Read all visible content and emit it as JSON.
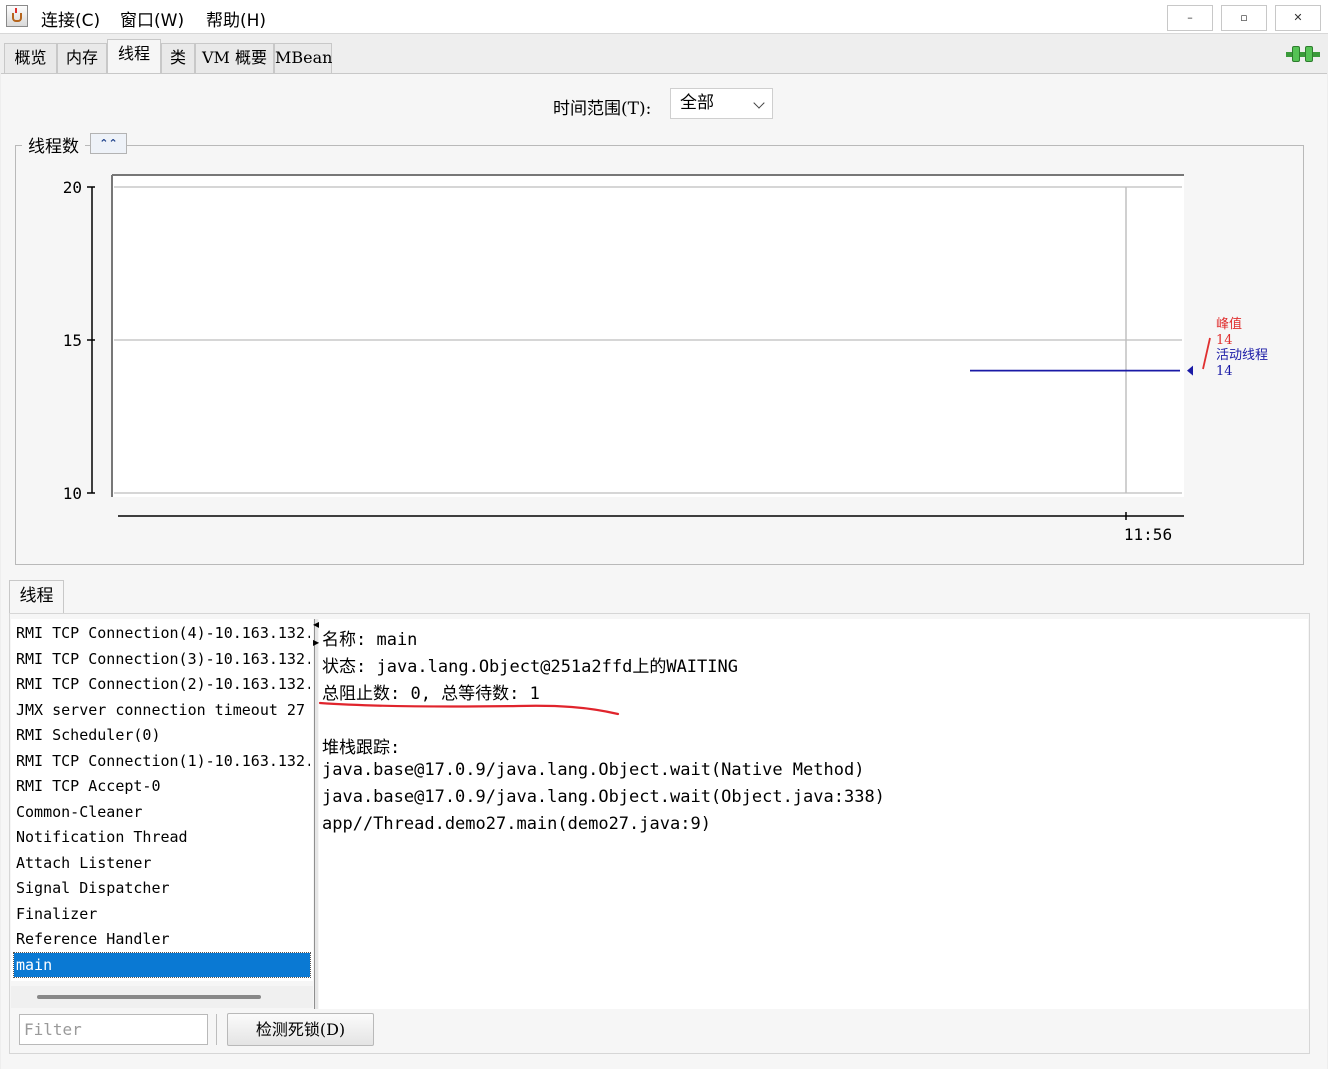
{
  "menubar": {
    "items": [
      "连接(C)",
      "窗口(W)",
      "帮助(H)"
    ],
    "buttons": {
      "minimize": "–",
      "restore": "▫",
      "close": "✕"
    }
  },
  "tabs": [
    "概览",
    "内存",
    "线程",
    "类",
    "VM 概要",
    "MBean"
  ],
  "active_tab": "线程",
  "time_range": {
    "label": "时间范围(T):",
    "value": "全部"
  },
  "chart_panel": {
    "title": "线程数",
    "collapse_icon": "double-chevron-up-icon"
  },
  "chart_data": {
    "type": "line",
    "y_ticks": [
      "20",
      "15",
      "10"
    ],
    "ylim": [
      10,
      20
    ],
    "x_ticks": [
      "11:56"
    ],
    "grid": true,
    "series": [
      {
        "name": "峰值",
        "last_value": "14",
        "color": "#e03030",
        "values": [
          14
        ]
      },
      {
        "name": "活动线程",
        "last_value": "14",
        "color": "#1a1aa6",
        "values": [
          14,
          14
        ]
      }
    ],
    "legend_position": "right"
  },
  "threads": {
    "tab_label": "线程",
    "items": [
      "RMI TCP Connection(4)-10.163.132.",
      "RMI TCP Connection(3)-10.163.132.",
      "RMI TCP Connection(2)-10.163.132.",
      "JMX server connection timeout 27",
      "RMI Scheduler(0)",
      "RMI TCP Connection(1)-10.163.132.",
      "RMI TCP Accept-0",
      "Common-Cleaner",
      "Notification Thread",
      "Attach Listener",
      "Signal Dispatcher",
      "Finalizer",
      "Reference Handler",
      "main"
    ],
    "selected": "main"
  },
  "detail": {
    "name_line": "名称: main",
    "state_line": "状态: java.lang.Object@251a2ffd上的WAITING",
    "counts_line": "总阻止数: 0, 总等待数: 1",
    "stack_header": "堆栈跟踪:",
    "stack": [
      "java.base@17.0.9/java.lang.Object.wait(Native Method)",
      "java.base@17.0.9/java.lang.Object.wait(Object.java:338)",
      "app//Thread.demo27.main(demo27.java:9)"
    ],
    "annotation_color": "#e0242c"
  },
  "filter": {
    "placeholder": "Filter",
    "value": ""
  },
  "deadlock_button": "检测死锁(D)",
  "connection_icon": "connected-plug-icon"
}
